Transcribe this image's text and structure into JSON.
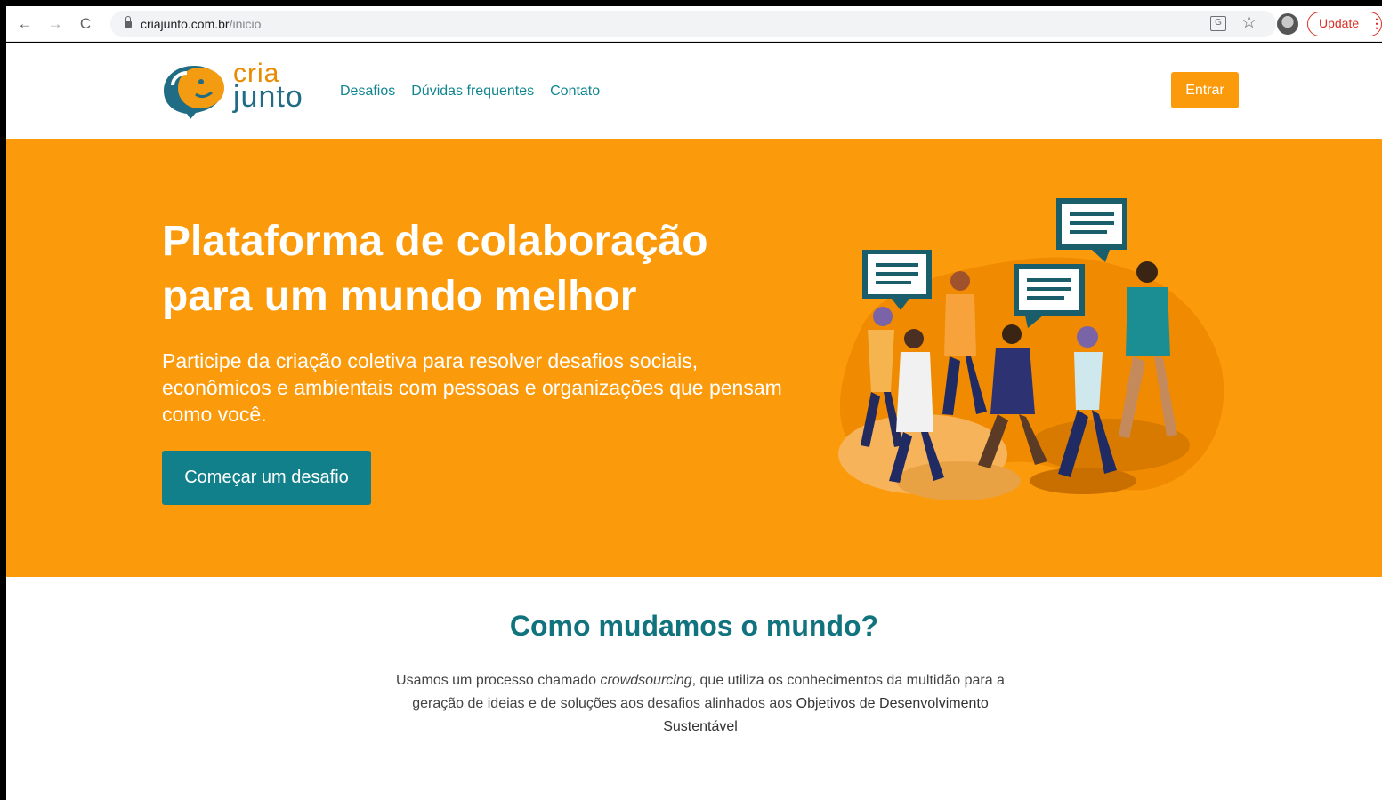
{
  "browser": {
    "back_icon": "←",
    "forward_icon": "→",
    "reload_icon": "C",
    "url_domain": "criajunto.com.br",
    "url_path": "/inicio",
    "translate_icon": "G",
    "star_icon": "☆",
    "update_label": "Update",
    "menu_dots": "⋮"
  },
  "header": {
    "logo_top": "cria",
    "logo_bottom": "junto",
    "nav": [
      "Desafios",
      "Dúvidas frequentes",
      "Contato"
    ],
    "login_label": "Entrar"
  },
  "hero": {
    "title": "Plataforma de colaboração para um mundo melhor",
    "subtitle": "Participe da criação coletiva para resolver desafios sociais, econômicos e ambientais com pessoas e organizações que pensam como você.",
    "cta_label": "Começar um desafio"
  },
  "how": {
    "title": "Como mudamos o mundo?",
    "text_before": "Usamos um processo chamado ",
    "text_emphasis": "crowdsourcing",
    "text_middle": ", que utiliza os conhecimentos da multidão para a geração de ideias e de soluções aos desafios alinhados aos ",
    "text_link": "Objetivos de Desenvolvimento Sustentável"
  },
  "colors": {
    "orange": "#fb9a0b",
    "teal": "#11808a",
    "logo_blue": "#1f6c84",
    "update_red": "#d93025"
  }
}
